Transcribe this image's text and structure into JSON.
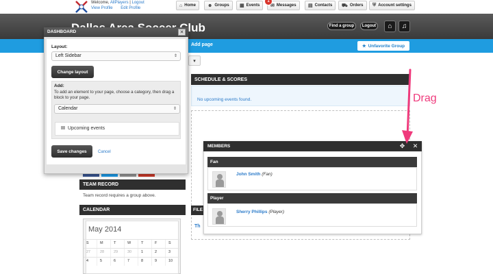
{
  "header": {
    "welcome_prefix": "Welcome, ",
    "welcome_user": "AllPlayers",
    "welcome_sep": " | ",
    "logout": "Logout",
    "view_profile": "View Profile",
    "edit_profile": "Edit Profile",
    "nav": [
      {
        "label": "Home",
        "icon": "home-icon"
      },
      {
        "label": "Groups",
        "icon": "groups-icon"
      },
      {
        "label": "Events",
        "icon": "calendar-icon"
      },
      {
        "label": "Messages",
        "icon": "envelope-icon"
      },
      {
        "label": "Contacts",
        "icon": "contacts-icon"
      },
      {
        "label": "Orders",
        "icon": "cart-icon"
      },
      {
        "label": "Account settings",
        "icon": "shield-icon"
      }
    ],
    "messages_badge": "1"
  },
  "club": {
    "title": "Dallas Area Soccer Club",
    "find_group": "Find a group",
    "logout": "Logout"
  },
  "bluebar": {
    "add_page": "Add page",
    "unfavorite": "Unfavorite Group"
  },
  "schedule": {
    "title": "SCHEDULE & SCORES",
    "empty": "No upcoming events found."
  },
  "left": {
    "team_record_title": "TEAM RECORD",
    "team_record_text": "Team record requires a group above.",
    "calendar_title": "CALENDAR",
    "month": "May 2014",
    "weekdays": [
      "S",
      "M",
      "T",
      "W",
      "T",
      "F",
      "S"
    ],
    "weeks": [
      [
        "27",
        "28",
        "29",
        "30",
        "1",
        "2",
        "3"
      ],
      [
        "4",
        "5",
        "6",
        "7",
        "8",
        "9",
        "10"
      ]
    ]
  },
  "files_stub": "FILE",
  "th_stub": "Th",
  "members": {
    "title": "MEMBERS",
    "groups": [
      {
        "name": "Fan",
        "member": "John Smith",
        "role": "(Fan)"
      },
      {
        "name": "Player",
        "member": "Sherry Phillips",
        "role": "(Player)"
      }
    ]
  },
  "annotation": {
    "drag": "Drag",
    "color": "#ef3a7c"
  },
  "dashboard": {
    "title": "DASHBOARD",
    "layout_label": "Layout:",
    "layout_value": "Left Sidebar",
    "change_layout": "Change layout",
    "add_label": "Add:",
    "add_help": "To add an element to your page, choose a category, then drag a block to your page.",
    "category_value": "Calendar",
    "block": "Upcoming events",
    "save": "Save changes",
    "cancel": "Cancel"
  }
}
